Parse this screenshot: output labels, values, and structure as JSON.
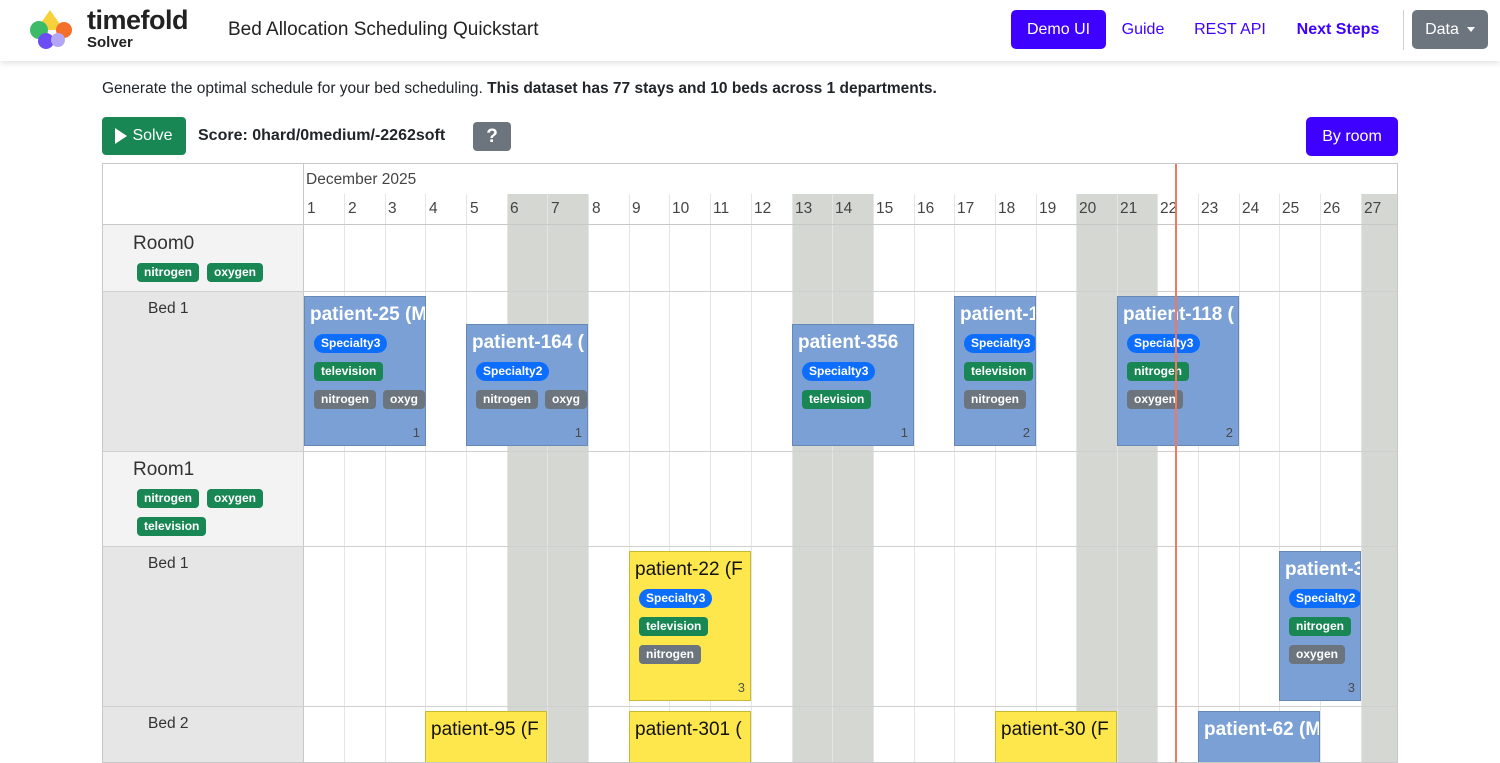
{
  "nav": {
    "brand": "timefold",
    "brand_sub": "Solver",
    "title": "Bed Allocation Scheduling Quickstart",
    "demo_ui": "Demo UI",
    "guide": "Guide",
    "rest_api": "REST API",
    "next_steps": "Next Steps",
    "data": "Data"
  },
  "description": {
    "text": "Generate the optimal schedule for your bed scheduling. ",
    "bold": "This dataset has 77 stays and 10 beds across 1 departments."
  },
  "toolbar": {
    "solve": "Solve",
    "score": "Score: 0hard/0medium/-2262soft",
    "help": "?",
    "by_room": "By room"
  },
  "colors": {
    "primary": "#3e00ff",
    "success": "#198754",
    "secondary": "#6c757d",
    "stay_blue": "#7aa0d5",
    "stay_yellow": "#fde74c",
    "now_line": "#f2775c"
  },
  "timeline": {
    "month": "December 2025",
    "days": [
      "1",
      "2",
      "3",
      "4",
      "5",
      "6",
      "7",
      "8",
      "9",
      "10",
      "11",
      "12",
      "13",
      "14",
      "15",
      "16",
      "17",
      "18",
      "19",
      "20",
      "21",
      "22",
      "23",
      "24",
      "25",
      "26",
      "27"
    ],
    "rooms": [
      {
        "name": "Room0",
        "tags": [
          "nitrogen",
          "oxygen"
        ],
        "beds": [
          "Bed 1"
        ]
      },
      {
        "name": "Room1",
        "tags": [
          "nitrogen",
          "oxygen",
          "television"
        ],
        "beds": [
          "Bed 1",
          "Bed 2"
        ]
      }
    ],
    "stays": [
      {
        "title": "patient-25 (M",
        "tags": [
          "Specialty3",
          "television",
          "nitrogen",
          "oxyg"
        ],
        "count": "1",
        "color": "blue"
      },
      {
        "title": "patient-164 (",
        "tags": [
          "Specialty2",
          "nitrogen",
          "oxyg"
        ],
        "count": "1",
        "color": "blue"
      },
      {
        "title": "patient-356",
        "tags": [
          "Specialty3",
          "television"
        ],
        "count": "1",
        "color": "blue"
      },
      {
        "title": "patient-1",
        "tags": [
          "Specialty3",
          "television",
          "nitrogen"
        ],
        "count": "2",
        "color": "blue"
      },
      {
        "title": "patient-118 (",
        "tags": [
          "Specialty3",
          "nitrogen",
          "oxygen"
        ],
        "count": "2",
        "color": "blue"
      },
      {
        "title": "patient-22 (F",
        "tags": [
          "Specialty3",
          "television",
          "nitrogen"
        ],
        "count": "3",
        "color": "yellow"
      },
      {
        "title": "patient-3",
        "tags": [
          "Specialty2",
          "nitrogen",
          "oxygen"
        ],
        "count": "3",
        "color": "blue"
      },
      {
        "title": "patient-95 (F",
        "color": "yellow"
      },
      {
        "title": "patient-301 (",
        "color": "yellow"
      },
      {
        "title": "patient-30 (F",
        "color": "yellow"
      },
      {
        "title": "patient-62 (M",
        "color": "blue"
      }
    ]
  }
}
